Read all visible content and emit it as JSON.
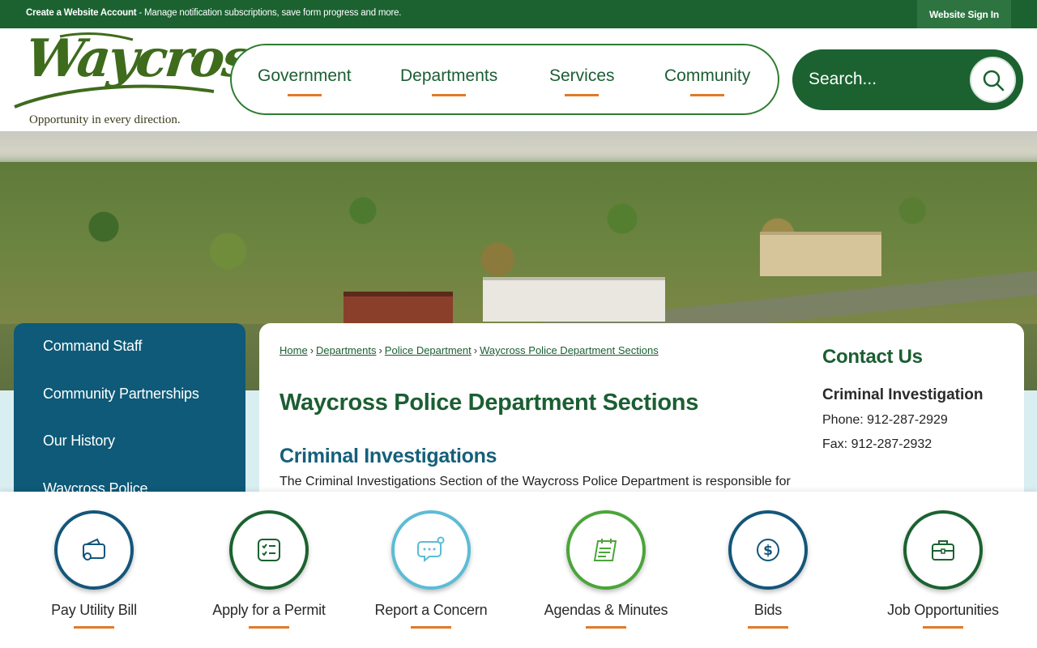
{
  "topbar": {
    "create_account_label": "Create a Website Account",
    "message": " - Manage notification subscriptions, save form progress and more.",
    "signin_label": "Website Sign In"
  },
  "logo": {
    "name": "Waycross",
    "tagline": "Opportunity in every direction."
  },
  "nav": {
    "items": [
      {
        "label": "Government"
      },
      {
        "label": "Departments"
      },
      {
        "label": "Services"
      },
      {
        "label": "Community"
      }
    ]
  },
  "search": {
    "placeholder": "Search..."
  },
  "sidebar": {
    "items": [
      {
        "label": "Command Staff"
      },
      {
        "label": "Community Partnerships"
      },
      {
        "label": "Our History"
      },
      {
        "label": "Waycross Police"
      }
    ]
  },
  "breadcrumb": {
    "items": [
      {
        "label": "Home"
      },
      {
        "label": "Departments"
      },
      {
        "label": "Police Department"
      },
      {
        "label": "Waycross Police Department Sections"
      }
    ],
    "separator": "›"
  },
  "main": {
    "page_title": "Waycross Police Department Sections",
    "section_title": "Criminal Investigations",
    "paragraph": "The Criminal Investigations Section of the Waycross Police Department is responsible for"
  },
  "contact": {
    "heading": "Contact Us",
    "name": "Criminal Investigation",
    "phone": "Phone: 912-287-2929",
    "fax": "Fax: 912-287-2932"
  },
  "quick_links": [
    {
      "label": "Pay Utility Bill",
      "icon": "wallet-icon",
      "ring_color": "#14567a"
    },
    {
      "label": "Apply for a Permit",
      "icon": "checklist-icon",
      "ring_color": "#1b6230"
    },
    {
      "label": "Report a Concern",
      "icon": "chat-bubble-icon",
      "ring_color": "#5bbcd6"
    },
    {
      "label": "Agendas & Minutes",
      "icon": "calendar-notes-icon",
      "ring_color": "#4aa53a"
    },
    {
      "label": "Bids",
      "icon": "dollar-icon",
      "ring_color": "#14567a"
    },
    {
      "label": "Job Opportunities",
      "icon": "briefcase-icon",
      "ring_color": "#1b6230"
    }
  ],
  "colors": {
    "brand_green": "#1b6230",
    "accent_orange": "#e07a2a",
    "sidebar_blue": "#0e5a78"
  }
}
